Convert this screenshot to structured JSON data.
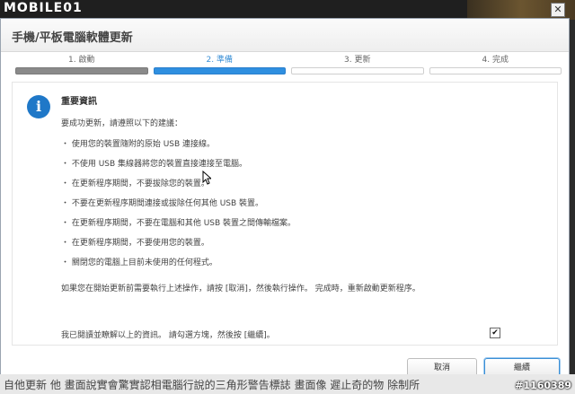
{
  "watermark": {
    "logo": "MOBILE01",
    "post_id": "#1160389",
    "bottom_text": "自他更新 他 畫面說實會驚實認相電腦行說的三角形警告標誌 畫面像 遲止奇的物  除制所"
  },
  "window": {
    "title": "手機/平板電腦軟體更新",
    "close_glyph": "✕"
  },
  "steps": [
    {
      "label": "1. 啟動",
      "state": "done"
    },
    {
      "label": "2. 準備",
      "state": "active"
    },
    {
      "label": "3. 更新",
      "state": "pending"
    },
    {
      "label": "4. 完成",
      "state": "pending"
    }
  ],
  "content": {
    "icon_glyph": "i",
    "heading": "重要資訊",
    "intro": "要成功更新，請遵照以下的建議：",
    "items": [
      "・ 使用您的裝置隨附的原始 USB 連接線。",
      "・ 不使用 USB 集線器將您的裝置直接連接至電腦。",
      "・ 在更新程序期間，不要拔除您的裝置。",
      "・ 不要在更新程序期間連接或拔除任何其他 USB 裝置。",
      "・ 在更新程序期間，不要在電腦和其他 USB 裝置之間傳輸檔案。",
      "・ 在更新程序期間，不要使用您的裝置。",
      "・ 關閉您的電腦上目前未使用的任何程式。"
    ],
    "note": "如果您在開始更新前需要執行上述操作，請按 [取消]，然後執行操作。 完成時，重新啟動更新程序。",
    "agree": "我已閱讀並瞭解以上的資訊。 請勾選方塊，然後按 [繼續]。",
    "checkbox_glyph": "✔"
  },
  "buttons": {
    "cancel": "取消",
    "continue": "繼續"
  },
  "colors": {
    "accent": "#2f8fe0",
    "info_icon": "#1f78c8",
    "done_bar": "#8a8a8a"
  }
}
